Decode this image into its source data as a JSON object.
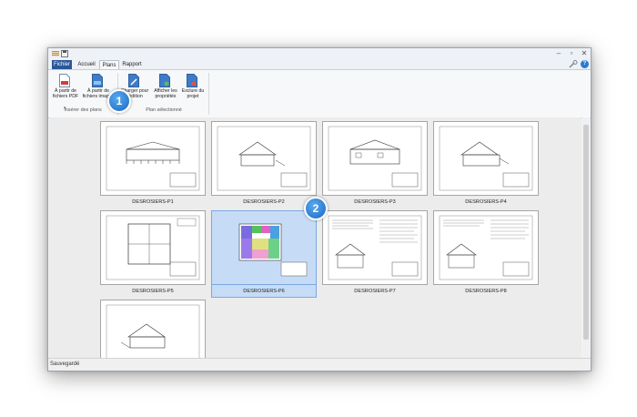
{
  "tabs": [
    "Fichier",
    "Accueil",
    "Plans",
    "Rapport"
  ],
  "ribbon": {
    "buttons": [
      {
        "label": "À partir de fichiers PDF",
        "icon": "pdf-import-icon"
      },
      {
        "label": "À partir de fichiers images",
        "icon": "image-import-icon"
      },
      {
        "label": "Charger pour l'édition",
        "icon": "load-edit-icon"
      },
      {
        "label": "Afficher les propriétés",
        "icon": "properties-icon"
      },
      {
        "label": "Exclure du projet",
        "icon": "exclude-icon"
      }
    ],
    "groups": [
      "Insérer des plans",
      "Plan sélectionné"
    ]
  },
  "plans": [
    {
      "name": "DESROSIERS-P1"
    },
    {
      "name": "DESROSIERS-P2"
    },
    {
      "name": "DESROSIERS-P3"
    },
    {
      "name": "DESROSIERS-P4"
    },
    {
      "name": "DESROSIERS-P5"
    },
    {
      "name": "DESROSIERS-P6"
    },
    {
      "name": "DESROSIERS-P7"
    },
    {
      "name": "DESROSIERS-P8"
    },
    {
      "name": ""
    }
  ],
  "callouts": [
    "1",
    "2"
  ],
  "status": "Sauvegardé"
}
